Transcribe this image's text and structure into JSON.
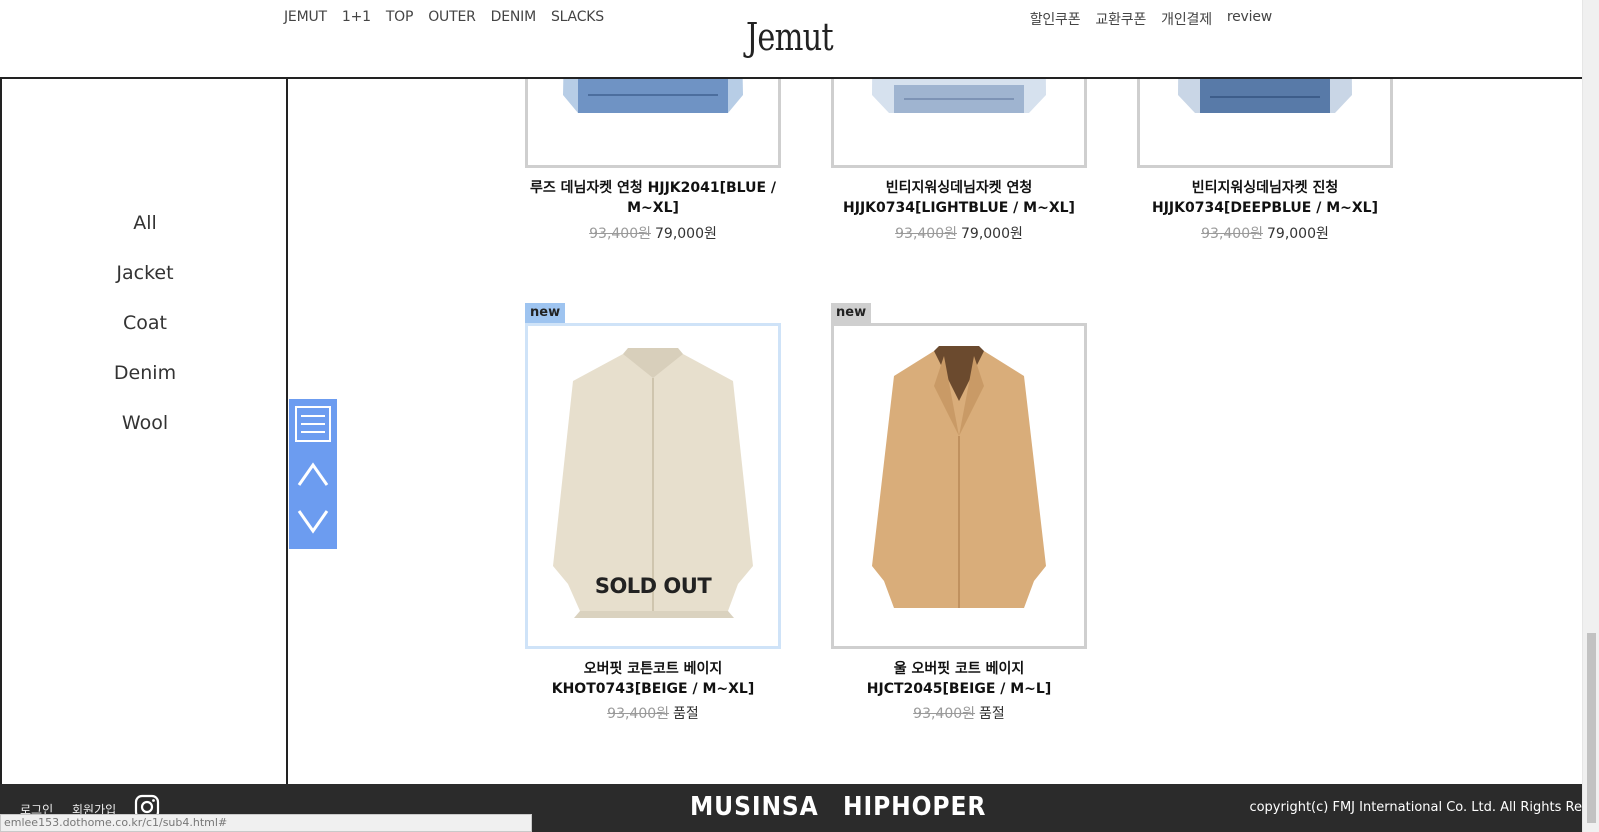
{
  "header": {
    "nav_left": [
      "JEMUT",
      "1+1",
      "TOP",
      "OUTER",
      "DENIM",
      "SLACKS"
    ],
    "logo": "Jemut",
    "nav_right": [
      "할인쿠폰",
      "교환쿠폰",
      "개인결제",
      "review"
    ]
  },
  "sidebar": {
    "categories": [
      "All",
      "Jacket",
      "Coat",
      "Denim",
      "Wool"
    ]
  },
  "products": [
    {
      "name_line1": "루즈 데님자켓 연청 HJJK2041[BLUE /",
      "name_line2": "M~XL]",
      "old_price": "93,400원",
      "price": "79,000원"
    },
    {
      "name_line1": "빈티지워싱데님자켓 연청",
      "name_line2": "HJJK0734[LIGHTBLUE / M~XL]",
      "old_price": "93,400원",
      "price": "79,000원"
    },
    {
      "name_line1": "빈티지워싱데님자켓 진청",
      "name_line2": "HJJK0734[DEEPBLUE / M~XL]",
      "old_price": "93,400원",
      "price": "79,000원"
    },
    {
      "badge": "new",
      "name_line1": "오버핏 코튼코트 베이지",
      "name_line2": "KHOT0743[BEIGE / M~XL]",
      "old_price": "93,400원",
      "price": "품절",
      "overlay": "SOLD OUT"
    },
    {
      "badge": "new",
      "name_line1": "울 오버핏 코트 베이지",
      "name_line2": "HJCT2045[BEIGE / M~L]",
      "old_price": "93,400원",
      "price": "품절"
    }
  ],
  "footer": {
    "login": "로그인",
    "join": "회원가입",
    "brand1": "MUSINSA",
    "brand2": "HIPHOPER",
    "copyright": "copyright(c) FMJ International Co. Ltd. All Rights Re"
  },
  "status_bar": "emlee153.dothome.co.kr/c1/sub4.html#",
  "colors": {
    "quick_menu": "#6c9cf0",
    "badge_blue": "#9ec4f0",
    "badge_gray": "#cfcfcf",
    "footer_bg": "#2b2b2b"
  }
}
